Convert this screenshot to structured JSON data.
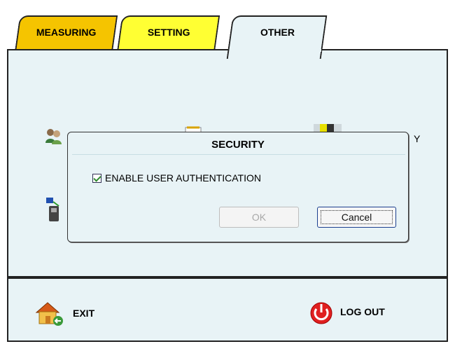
{
  "tabs": [
    {
      "label": "MEASURING",
      "color": "#f5c400"
    },
    {
      "label": "SETTING",
      "color": "#ffff33"
    },
    {
      "label": "OTHER",
      "color": "#e8f3f6",
      "active": true
    }
  ],
  "background": {
    "partial_text": "Y",
    "icons": [
      "users-icon",
      "notepad-icon",
      "shield-icon",
      "device-icon"
    ]
  },
  "dialog": {
    "title": "SECURITY",
    "checkbox_label": "ENABLE USER AUTHENTICATION",
    "checkbox_checked": true,
    "ok_label": "OK",
    "cancel_label": "Cancel"
  },
  "footer": {
    "exit_label": "EXIT",
    "logout_label": "LOG OUT"
  },
  "colors": {
    "panel_bg": "#e8f3f6",
    "measuring_tab": "#f5c400",
    "setting_tab": "#ffff33",
    "logout_red": "#e02020"
  }
}
